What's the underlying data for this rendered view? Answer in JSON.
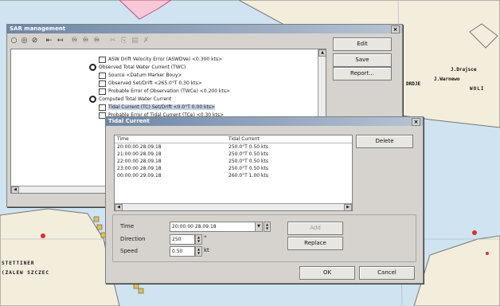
{
  "colors": {
    "sea": "#cfe3f0",
    "land": "#f3eddc",
    "coast": "#777777",
    "dialog": "#d6d3ce",
    "title": "#6d86a6",
    "selection": "#c8d2e6"
  },
  "map": {
    "labels": {
      "left_line1": "STETTINER",
      "left_line2": "(ZALEW SZCZEC",
      "right1": "J.Drajsce",
      "right2": "J.Warnewo",
      "right3": "WOLI",
      "right4": "DRDJE"
    }
  },
  "sar_window": {
    "title": "SAR management",
    "toolbar_icons": [
      "circle-icon",
      "target-icon",
      "no-entry-icon",
      "first-icon",
      "back-icon",
      "binoculars-icon",
      "binoculars-icon",
      "binoculars-icon",
      "cut-icon",
      "copy-icon",
      "paste-icon",
      "delete-icon"
    ],
    "tree": [
      {
        "icon": "doc",
        "label": "ASW Drift Velocity Error (ASWDVe) <0.300 kts>",
        "indent": 12
      },
      {
        "icon": "circle",
        "label": "Observed Total Water Current (TWC)",
        "indent": 0
      },
      {
        "icon": "doc",
        "label": "Source <Datum Marker Bouy>",
        "indent": 12
      },
      {
        "icon": "doc",
        "label": "Observed Set/Drift <265.0°T 0.30 kts>",
        "indent": 12
      },
      {
        "icon": "doc",
        "label": "Probable Error of Observation (TWCe) <0.200 kts>",
        "indent": 12
      },
      {
        "icon": "circle",
        "label": "Computed Total Water Current",
        "indent": 0
      },
      {
        "icon": "doc",
        "label": "Tidal Current (TC) Set/Drift <0.0°T 0.00 kts>",
        "indent": 12,
        "selected": true
      },
      {
        "icon": "doc",
        "label": "Probable Error of Tidal Current (TCe) <0.30 kts>",
        "indent": 12
      }
    ],
    "buttons": {
      "edit": "Edit",
      "save": "Save",
      "report": "Report..."
    }
  },
  "tidal_dialog": {
    "title": "Tidal Current",
    "columns": [
      "Time",
      "Tidal Current"
    ],
    "rows": [
      {
        "time": "20:00:00 28.09.18",
        "current": "250.0°T 0.50 kts"
      },
      {
        "time": "21:00:00 28.09.18",
        "current": "250.0°T 0.50 kts"
      },
      {
        "time": "22:00:00 28.09.18",
        "current": "250.0°T 0.50 kts"
      },
      {
        "time": "23:00:00 28.09.18",
        "current": "250.0°T 0.50 kts"
      },
      {
        "time": "00:00:00 29.09.18",
        "current": "260.0°T 1.00 kts"
      }
    ],
    "labels": {
      "time": "Time",
      "direction": "Direction",
      "speed": "Speed"
    },
    "values": {
      "time": "20:00:00 28.09.18",
      "direction": "250",
      "direction_unit": "°",
      "speed": "0.50",
      "speed_unit": "kt"
    },
    "buttons": {
      "delete": "Delete",
      "add": "Add",
      "replace": "Replace",
      "ok": "OK",
      "cancel": "Cancel"
    }
  }
}
